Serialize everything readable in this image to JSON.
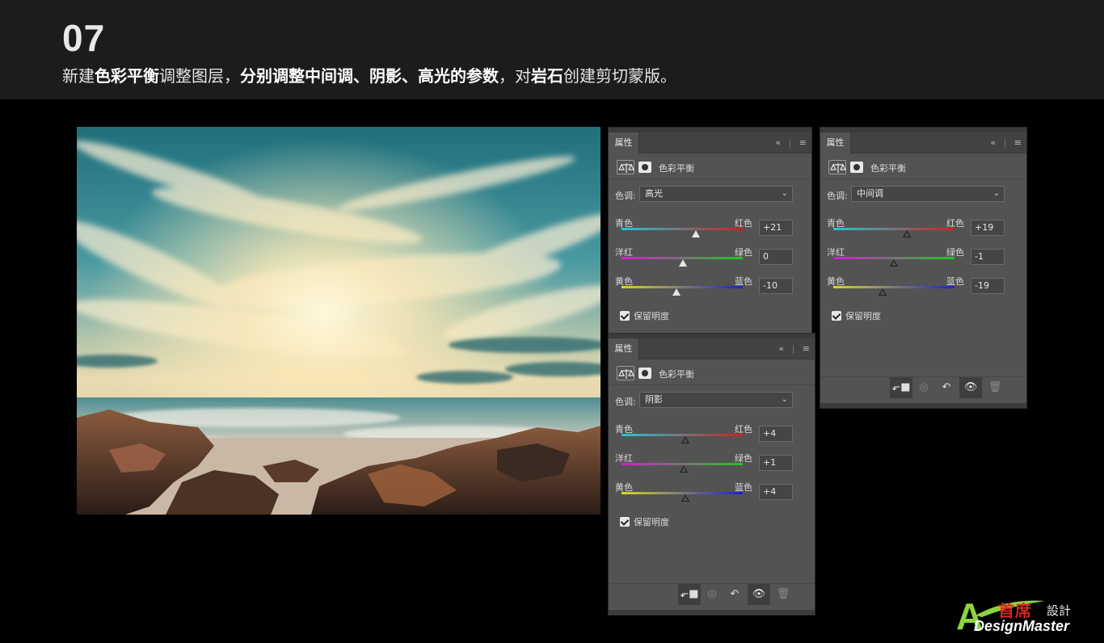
{
  "slide": {
    "step": "07",
    "caption": [
      {
        "t": "新建",
        "b": false
      },
      {
        "t": "色彩平衡",
        "b": true
      },
      {
        "t": "调整图层，",
        "b": false
      },
      {
        "t": "分别调整中间调、阴影、高光的参数",
        "b": true
      },
      {
        "t": "，对",
        "b": false
      },
      {
        "t": "岩石",
        "b": true
      },
      {
        "t": "创建剪切蒙版。",
        "b": false
      }
    ]
  },
  "panels": {
    "highlights": {
      "tab": "属性",
      "title": "色彩平衡",
      "tone_label": "色调:",
      "tone": "高光",
      "cyan": "青色",
      "red": "红色",
      "cyan_red_value": "+21",
      "magenta": "洋红",
      "green": "绿色",
      "magenta_green_value": "0",
      "yellow": "黄色",
      "blue": "蓝色",
      "yellow_blue_value": "-10",
      "preserve": "保留明度"
    },
    "shadows": {
      "tab": "属性",
      "title": "色彩平衡",
      "tone_label": "色调:",
      "tone": "阴影",
      "cyan": "青色",
      "red": "红色",
      "cyan_red_value": "+4",
      "magenta": "洋红",
      "green": "绿色",
      "magenta_green_value": "+1",
      "yellow": "黄色",
      "blue": "蓝色",
      "yellow_blue_value": "+4",
      "preserve": "保留明度"
    },
    "midtones": {
      "tab": "属性",
      "title": "色彩平衡",
      "tone_label": "色调:",
      "tone": "中间调",
      "cyan": "青色",
      "red": "红色",
      "cyan_red_value": "+19",
      "magenta": "洋红",
      "green": "绿色",
      "magenta_green_value": "-1",
      "yellow": "黄色",
      "blue": "蓝色",
      "yellow_blue_value": "-19",
      "preserve": "保留明度"
    },
    "icons": {
      "collapse": "«",
      "menu": "≡",
      "chevron": "⌄",
      "clip": "clip-to-layer-icon",
      "view_previous": "view-previous-icon",
      "reset": "reset-icon",
      "visibility": "eye-icon",
      "delete": "trash-icon"
    }
  },
  "logo": {
    "letter": "A",
    "cn": "首席",
    "cn_small": "設計",
    "en": "DesignMaster",
    "colors": {
      "green": "#8dd33e",
      "red": "#d8261f"
    }
  },
  "colors": {
    "header_bg": "#1d1b1b",
    "panel_bg": "#535353",
    "page_bg": "#000000"
  }
}
